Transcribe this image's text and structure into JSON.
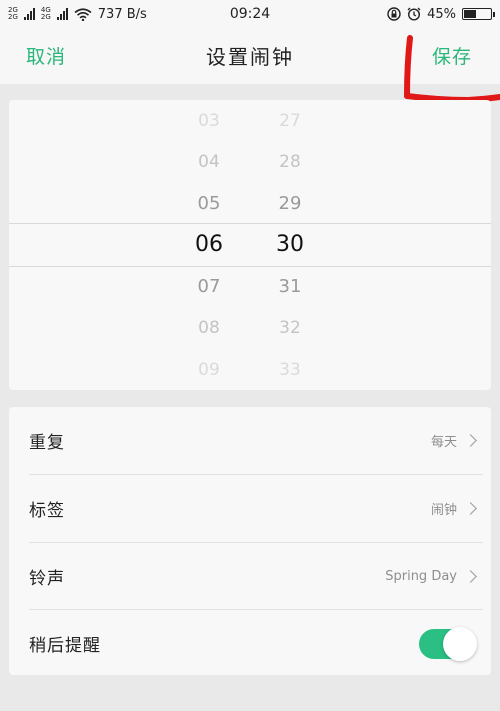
{
  "status_bar": {
    "network_top": "2G",
    "network_bottom": "2G",
    "network_top2": "4G",
    "network_bottom2": "2G",
    "speed": "737 B/s",
    "time": "09:24",
    "battery_percent": "45%",
    "battery_level": 0.45
  },
  "header": {
    "cancel_label": "取消",
    "title": "设置闹钟",
    "save_label": "保存",
    "accent_color": "#2bb67a"
  },
  "picker": {
    "hours": [
      "03",
      "04",
      "05",
      "06",
      "07",
      "08",
      "09"
    ],
    "minutes": [
      "27",
      "28",
      "29",
      "30",
      "31",
      "32",
      "33"
    ],
    "selected_hour": "06",
    "selected_minute": "30"
  },
  "settings": {
    "repeat": {
      "label": "重复",
      "value": "每天"
    },
    "tag": {
      "label": "标签",
      "value": "闹钟"
    },
    "ringtone": {
      "label": "铃声",
      "value": "Spring Day"
    },
    "snooze": {
      "label": "稍后提醒",
      "enabled": true,
      "toggle_color": "#2bbf84"
    }
  },
  "annotation": {
    "color": "#e01818"
  }
}
